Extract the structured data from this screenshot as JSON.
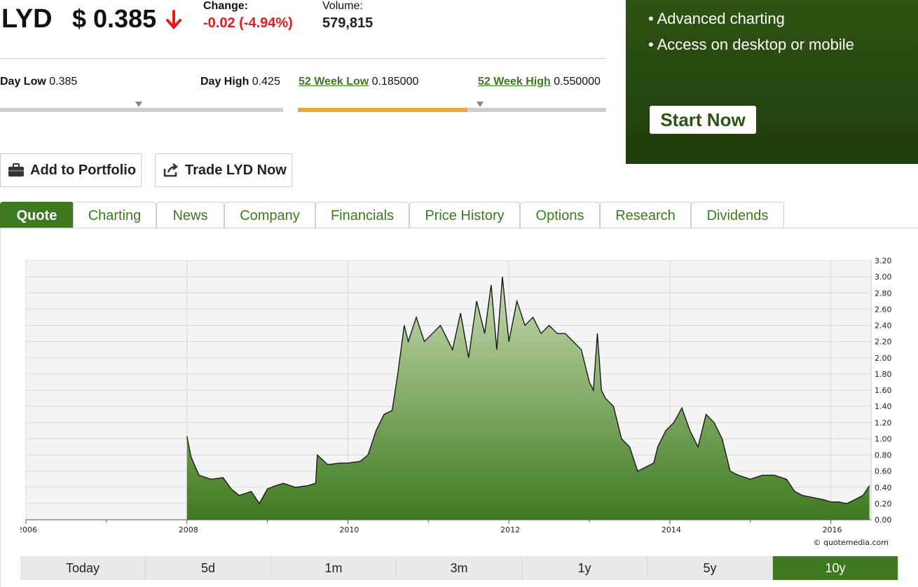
{
  "quote": {
    "ticker": "LYD",
    "price": "$ 0.385",
    "change_label": "Change:",
    "change_value": "-0.02 (-4.94%)",
    "volume_label": "Volume:",
    "volume_value": "579,815",
    "direction_icon": "arrow-down-icon",
    "down_color": "#e31b1b"
  },
  "ranges": {
    "day_low_label": "Day Low",
    "day_low_value": "0.385",
    "day_high_label": "Day High",
    "day_high_value": "0.425",
    "week52_low_label": "52 Week Low",
    "week52_low_value": "0.185000",
    "week52_high_label": "52 Week High",
    "week52_high_value": "0.550000",
    "day_marker_fraction": 0.49,
    "week52_fill_fraction": 0.55,
    "week52_marker_fraction": 0.59
  },
  "ad": {
    "bullets": [
      "• Advanced charting",
      "• Access on desktop or mobile"
    ],
    "button": "Start Now"
  },
  "actions": {
    "portfolio": "Add to Portfolio",
    "trade": "Trade LYD Now"
  },
  "tabs": [
    "Quote",
    "Charting",
    "News",
    "Company",
    "Financials",
    "Price History",
    "Options",
    "Research",
    "Dividends"
  ],
  "active_tab": "Quote",
  "range_buttons": [
    "Today",
    "5d",
    "1m",
    "3m",
    "1y",
    "5y",
    "10y"
  ],
  "active_range": "10y",
  "colors": {
    "brand_green": "#3d7a1f",
    "range_orange": "#f2a53a"
  },
  "chart_data": {
    "type": "area",
    "x_ticks": [
      "2006",
      "2008",
      "2010",
      "2012",
      "2014",
      "2016"
    ],
    "y_ticks": [
      "0.00",
      "0.20",
      "0.40",
      "0.60",
      "0.80",
      "1.00",
      "1.20",
      "1.40",
      "1.60",
      "1.80",
      "2.00",
      "2.20",
      "2.40",
      "2.60",
      "2.80",
      "3.00",
      "3.20"
    ],
    "xlim": [
      2006,
      2016.5
    ],
    "ylim": [
      0,
      3.2
    ],
    "watermark": "© quotemedia.com",
    "series": [
      {
        "x": [
          2008.0,
          2008.05,
          2008.15,
          2008.3,
          2008.45,
          2008.55,
          2008.65,
          2008.8,
          2008.9,
          2009.0,
          2009.1,
          2009.2,
          2009.35,
          2009.5,
          2009.6,
          2009.62,
          2009.75,
          2009.9,
          2010.0,
          2010.15,
          2010.25,
          2010.35,
          2010.45,
          2010.55,
          2010.62,
          2010.7,
          2010.75,
          2010.85,
          2010.95,
          2011.05,
          2011.15,
          2011.3,
          2011.4,
          2011.5,
          2011.6,
          2011.7,
          2011.78,
          2011.85,
          2011.92,
          2012.0,
          2012.1,
          2012.2,
          2012.3,
          2012.4,
          2012.5,
          2012.6,
          2012.7,
          2012.8,
          2012.9,
          2013.0,
          2013.05,
          2013.1,
          2013.15,
          2013.2,
          2013.3,
          2013.4,
          2013.5,
          2013.6,
          2013.7,
          2013.8,
          2013.85,
          2013.95,
          2014.05,
          2014.15,
          2014.25,
          2014.35,
          2014.45,
          2014.55,
          2014.65,
          2014.75,
          2014.85,
          2015.0,
          2015.15,
          2015.3,
          2015.45,
          2015.55,
          2015.65,
          2015.75,
          2015.9,
          2016.0,
          2016.1,
          2016.2,
          2016.3,
          2016.4,
          2016.48
        ],
        "y": [
          1.03,
          0.78,
          0.55,
          0.5,
          0.52,
          0.38,
          0.3,
          0.35,
          0.2,
          0.38,
          0.42,
          0.45,
          0.4,
          0.42,
          0.45,
          0.8,
          0.68,
          0.7,
          0.7,
          0.72,
          0.8,
          1.1,
          1.3,
          1.35,
          1.8,
          2.4,
          2.2,
          2.5,
          2.2,
          2.3,
          2.4,
          2.1,
          2.55,
          2.0,
          2.7,
          2.3,
          2.9,
          2.1,
          3.0,
          2.2,
          2.7,
          2.4,
          2.5,
          2.3,
          2.4,
          2.3,
          2.3,
          2.2,
          2.1,
          1.7,
          1.6,
          2.3,
          1.6,
          1.5,
          1.4,
          1.0,
          0.9,
          0.6,
          0.65,
          0.7,
          0.9,
          1.1,
          1.2,
          1.38,
          1.1,
          0.9,
          1.3,
          1.2,
          1.0,
          0.6,
          0.55,
          0.5,
          0.55,
          0.55,
          0.5,
          0.35,
          0.3,
          0.28,
          0.25,
          0.22,
          0.22,
          0.2,
          0.25,
          0.3,
          0.42
        ]
      }
    ]
  }
}
